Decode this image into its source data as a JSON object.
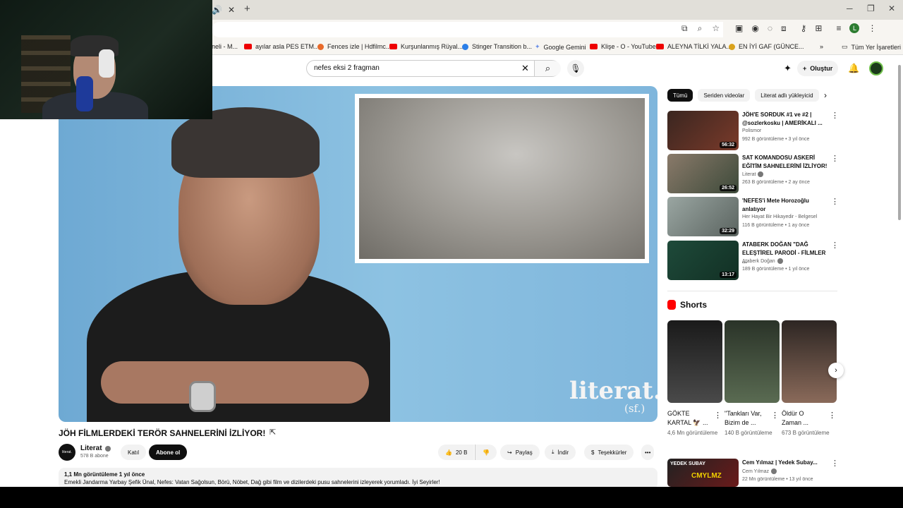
{
  "browser": {
    "tab_close": "✕",
    "new_tab": "+",
    "bookmarks": [
      {
        "label": "neli - M...",
        "color": "#888888"
      },
      {
        "label": "ayılar asla PES ETM...",
        "color": "#e00000"
      },
      {
        "label": "Fences izle | Hdfilmc...",
        "color": "#e86a2a"
      },
      {
        "label": "Kurşunlanmış Rüyal...",
        "color": "#e00000"
      },
      {
        "label": "Stinger Transition b...",
        "color": "#2a7ee8"
      },
      {
        "label": "Google Gemini",
        "color": "#6b8fe8"
      },
      {
        "label": "Klişe - O - YouTube",
        "color": "#e00000"
      },
      {
        "label": "ALEYNA TİLKİ YALA...",
        "color": "#e00000"
      },
      {
        "label": "EN İYİ GAF (GÜNCE...",
        "color": "#d9a21b"
      }
    ],
    "all_bookmarks": "Tüm Yer İşaretleri",
    "profile_letter": "L"
  },
  "youtube": {
    "search_query": "nefes eksi 2 fragman",
    "create_label": "Oluştur"
  },
  "video": {
    "brand": "literat.",
    "brand_sub": "(sf.)",
    "title": "JÖH FİLMLERDEKİ TERÖR SAHNELERİNİ İZLİYOR!",
    "channel_avatar_text": "literat.",
    "channel_name": "Literat",
    "subscribers": "578 B abone",
    "join_label": "Katıl",
    "subscribe_label": "Abone ol",
    "likes": "20 B",
    "share_label": "Paylaş",
    "download_label": "İndir",
    "thanks_label": "Teşekkürler",
    "views_meta": "1,1 Mn görüntüleme  1 yıl önce",
    "description": "Emekli Jandarma Yarbay Şefik Ünal, Nefes: Vatan Sağolsun, Börü, Nöbet, Dağ gibi film ve dizilerdeki pusu sahnelerini izleyerek yorumladı. İyi Seyirler!"
  },
  "sidebar": {
    "chips": [
      "Tümü",
      "Seriden videolar",
      "Literat adlı yükleyicid"
    ],
    "recommendations": [
      {
        "title": "JÖH'E SORDUK #1 ve #2 | @sozlerkosku | AMERİKALI ...",
        "channel": "Polismor",
        "views": "992 B görüntüleme • 3 yıl önce",
        "duration": "56:32",
        "verified": false,
        "thumb_color": "#3a2620"
      },
      {
        "title": "SAT KOMANDOSU ASKERİ EĞİTİM SAHNELERİNİ İZLİYOR!",
        "channel": "Literat",
        "views": "263 B görüntüleme • 2 ay önce",
        "duration": "26:52",
        "verified": true,
        "thumb_color": "#5d6a5a"
      },
      {
        "title": "'NEFES'i Mete Horozoğlu anlatıyor",
        "channel": "Her Hayat Bir Hikayedir - Belgesel",
        "views": "116 B görüntüleme • 1 ay önce",
        "duration": "32:29",
        "verified": false,
        "thumb_color": "#7d8a86"
      },
      {
        "title": "ATABERK DOĞAN \"DAĞ ELEŞTİREL PARODİ - FİLMLER ...",
        "channel": "Ataberk Doğan",
        "views": "189 B görüntüleme • 1 yıl önce",
        "duration": "13:17",
        "verified": true,
        "thumb_color": "#1e4a3a"
      }
    ],
    "shorts_title": "Shorts",
    "shorts": [
      {
        "title": "GÖKTE KARTAL 🦅 ...",
        "views": "4,6 Mn görüntüleme",
        "thumb_color": "#2b2b2b"
      },
      {
        "title": "\"Tankları Var, Bizim de ...",
        "views": "140 B görüntüleme",
        "thumb_color": "#3e4a3a"
      },
      {
        "title": "Öldür O Zaman ...",
        "views": "673 B görüntüleme",
        "thumb_color": "#2d2623"
      }
    ],
    "bottom_rec": {
      "title": "Cem Yılmaz | Yedek Subay...",
      "channel": "Cem Yılmaz",
      "views": "22 Mn görüntüleme • 13 yıl önce",
      "thumb_text": "YEDEK SUBAY",
      "thumb_text2": "CMYLMZ"
    }
  }
}
